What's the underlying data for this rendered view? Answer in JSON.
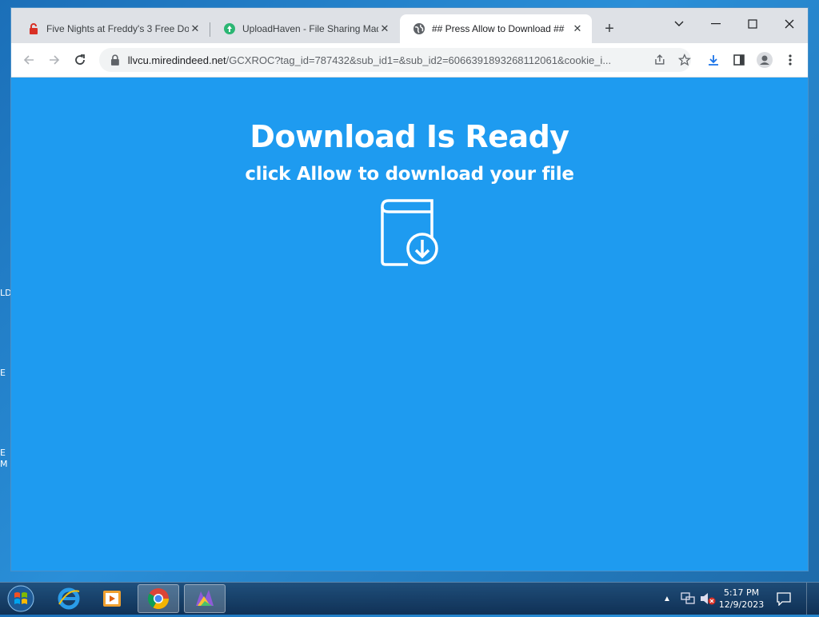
{
  "desktop": {
    "edge_fragments": [
      "LD",
      "E",
      "E",
      "M"
    ]
  },
  "browser": {
    "tabs": [
      {
        "title": "Five Nights at Freddy's 3 Free Do",
        "favicon": "red-lock-icon",
        "active": false
      },
      {
        "title": "UploadHaven - File Sharing Mad",
        "favicon": "uploadhaven-logo-icon",
        "active": false
      },
      {
        "title": "## Press Allow to Download ##",
        "favicon": "globe-icon",
        "active": true
      }
    ],
    "url": {
      "domain": "llvcu.miredindeed.net",
      "path": "/GCXROC?tag_id=787432&sub_id1=&sub_id2=6066391893268112061&cookie_i..."
    }
  },
  "page": {
    "headline": "Download Is Ready",
    "subline": "click Allow to download your file",
    "background_color": "#1e9bf0"
  },
  "taskbar": {
    "apps": [
      "internet-explorer-icon",
      "media-player-icon",
      "chrome-icon",
      "app-icon"
    ],
    "clock": {
      "time": "5:17 PM",
      "date": "12/9/2023"
    }
  }
}
